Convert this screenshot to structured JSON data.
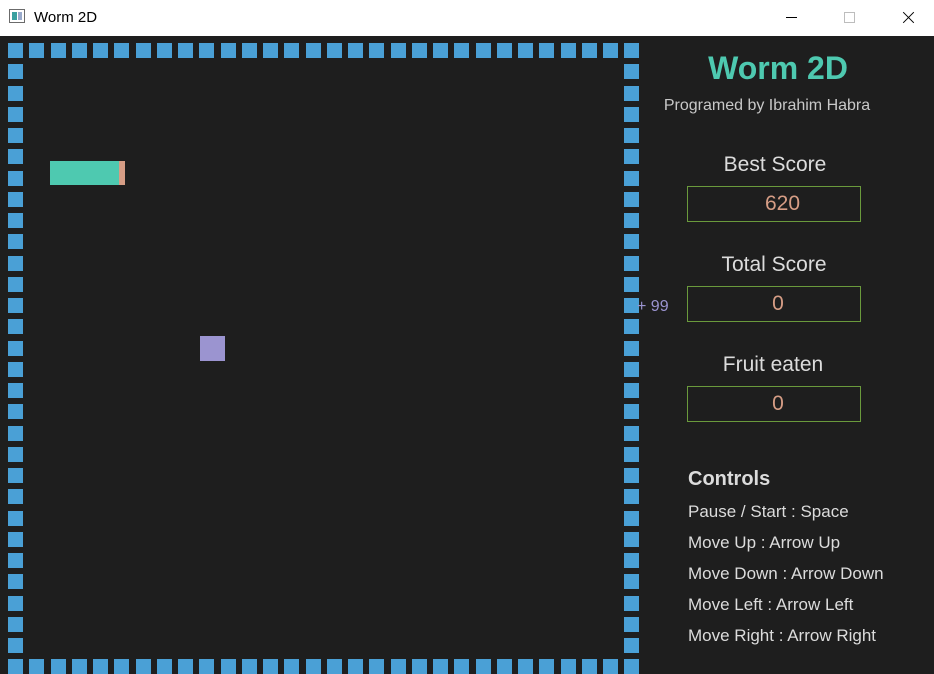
{
  "window": {
    "title": "Worm 2D"
  },
  "colors": {
    "border_block": "#4aa0d6",
    "worm_body": "#4ec9b0",
    "worm_head": "#d69d85",
    "fruit": "#9b94d0",
    "title": "#4ec9b0",
    "score_value": "#d69d85",
    "score_box_border": "#6a9a3c"
  },
  "panel": {
    "title": "Worm 2D",
    "credit": "Programed by Ibrahim Habra",
    "best_label": "Best Score",
    "best_value": "620",
    "total_label": "Total Score",
    "total_value": "0",
    "bonus": "+ 99",
    "fruit_label": "Fruit eaten",
    "fruit_value": "0",
    "controls_title": "Controls",
    "controls": [
      "Pause / Start : Space",
      "Move Up : Arrow Up",
      "Move Down : Arrow Down",
      "Move Left : Arrow Left",
      "Move Right : Arrow Right"
    ]
  }
}
